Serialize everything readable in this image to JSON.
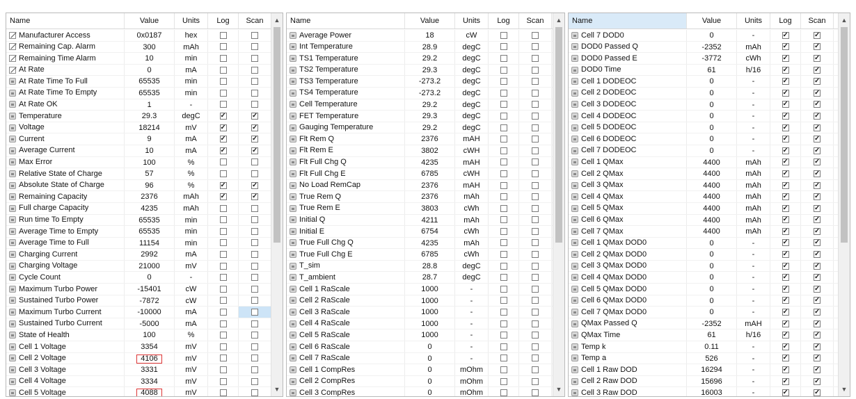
{
  "columns": {
    "name": "Name",
    "value": "Value",
    "units": "Units",
    "log": "Log",
    "scan": "Scan"
  },
  "scroll_icons": {
    "up": "▲",
    "down": "▼"
  },
  "panels": [
    {
      "rows": [
        {
          "name": "Manufacturer Access",
          "value": "0x0187",
          "units": "hex",
          "log": false,
          "scan": false,
          "icon": "pencil"
        },
        {
          "name": "Remaining Cap. Alarm",
          "value": "300",
          "units": "mAh",
          "log": false,
          "scan": false,
          "icon": "pencil"
        },
        {
          "name": "Remaining Time Alarm",
          "value": "10",
          "units": "min",
          "log": false,
          "scan": false,
          "icon": "pencil"
        },
        {
          "name": "At Rate",
          "value": "0",
          "units": "mA",
          "log": false,
          "scan": false,
          "icon": "pencil"
        },
        {
          "name": "At Rate Time To Full",
          "value": "65535",
          "units": "min",
          "log": false,
          "scan": false,
          "icon": "lock"
        },
        {
          "name": "At Rate Time To Empty",
          "value": "65535",
          "units": "min",
          "log": false,
          "scan": false,
          "icon": "lock"
        },
        {
          "name": "At Rate OK",
          "value": "1",
          "units": "-",
          "log": false,
          "scan": false,
          "icon": "lock"
        },
        {
          "name": "Temperature",
          "value": "29.3",
          "units": "degC",
          "log": true,
          "scan": true,
          "icon": "lock"
        },
        {
          "name": "Voltage",
          "value": "18214",
          "units": "mV",
          "log": true,
          "scan": true,
          "icon": "lock"
        },
        {
          "name": "Current",
          "value": "9",
          "units": "mA",
          "log": true,
          "scan": true,
          "icon": "lock"
        },
        {
          "name": "Average Current",
          "value": "10",
          "units": "mA",
          "log": true,
          "scan": true,
          "icon": "lock"
        },
        {
          "name": "Max Error",
          "value": "100",
          "units": "%",
          "log": false,
          "scan": false,
          "icon": "lock"
        },
        {
          "name": "Relative State of Charge",
          "value": "57",
          "units": "%",
          "log": false,
          "scan": false,
          "icon": "lock"
        },
        {
          "name": "Absolute State of Charge",
          "value": "96",
          "units": "%",
          "log": true,
          "scan": true,
          "icon": "lock"
        },
        {
          "name": "Remaining Capacity",
          "value": "2376",
          "units": "mAh",
          "log": true,
          "scan": true,
          "icon": "lock"
        },
        {
          "name": "Full charge Capacity",
          "value": "4235",
          "units": "mAh",
          "log": false,
          "scan": false,
          "icon": "lock"
        },
        {
          "name": "Run time To Empty",
          "value": "65535",
          "units": "min",
          "log": false,
          "scan": false,
          "icon": "lock"
        },
        {
          "name": "Average Time to Empty",
          "value": "65535",
          "units": "min",
          "log": false,
          "scan": false,
          "icon": "lock"
        },
        {
          "name": "Average Time to Full",
          "value": "11154",
          "units": "min",
          "log": false,
          "scan": false,
          "icon": "lock"
        },
        {
          "name": "Charging Current",
          "value": "2992",
          "units": "mA",
          "log": false,
          "scan": false,
          "icon": "lock"
        },
        {
          "name": "Charging Voltage",
          "value": "21000",
          "units": "mV",
          "log": false,
          "scan": false,
          "icon": "lock"
        },
        {
          "name": "Cycle Count",
          "value": "0",
          "units": "-",
          "log": false,
          "scan": false,
          "icon": "lock"
        },
        {
          "name": "Maximum Turbo Power",
          "value": "-15401",
          "units": "cW",
          "log": false,
          "scan": false,
          "icon": "lock"
        },
        {
          "name": "Sustained Turbo Power",
          "value": "-7872",
          "units": "cW",
          "log": false,
          "scan": false,
          "icon": "lock"
        },
        {
          "name": "Maximum Turbo Current",
          "value": "-10000",
          "units": "mA",
          "log": false,
          "scan": false,
          "icon": "lock",
          "scan_hl": true
        },
        {
          "name": "Sustained Turbo Current",
          "value": "-5000",
          "units": "mA",
          "log": false,
          "scan": false,
          "icon": "lock"
        },
        {
          "name": "State of Health",
          "value": "100",
          "units": "%",
          "log": false,
          "scan": false,
          "icon": "lock"
        },
        {
          "name": "Cell 1 Voltage",
          "value": "3354",
          "units": "mV",
          "log": false,
          "scan": false,
          "icon": "lock"
        },
        {
          "name": "Cell 2 Voltage",
          "value": "4106",
          "units": "mV",
          "log": false,
          "scan": false,
          "icon": "lock",
          "flag": true
        },
        {
          "name": "Cell 3 Voltage",
          "value": "3331",
          "units": "mV",
          "log": false,
          "scan": false,
          "icon": "lock"
        },
        {
          "name": "Cell 4 Voltage",
          "value": "3334",
          "units": "mV",
          "log": false,
          "scan": false,
          "icon": "lock"
        },
        {
          "name": "Cell 5 Voltage",
          "value": "4088",
          "units": "mV",
          "log": false,
          "scan": false,
          "icon": "lock",
          "flag": true
        }
      ]
    },
    {
      "rows": [
        {
          "name": "Average Power",
          "value": "18",
          "units": "cW",
          "log": false,
          "scan": false,
          "icon": "lock"
        },
        {
          "name": "Int Temperature",
          "value": "28.9",
          "units": "degC",
          "log": false,
          "scan": false,
          "icon": "lock"
        },
        {
          "name": "TS1 Temperature",
          "value": "29.2",
          "units": "degC",
          "log": false,
          "scan": false,
          "icon": "lock"
        },
        {
          "name": "TS2 Temperature",
          "value": "29.3",
          "units": "degC",
          "log": false,
          "scan": false,
          "icon": "lock"
        },
        {
          "name": "TS3 Temperature",
          "value": "-273.2",
          "units": "degC",
          "log": false,
          "scan": false,
          "icon": "lock"
        },
        {
          "name": "TS4 Temperature",
          "value": "-273.2",
          "units": "degC",
          "log": false,
          "scan": false,
          "icon": "lock"
        },
        {
          "name": "Cell Temperature",
          "value": "29.2",
          "units": "degC",
          "log": false,
          "scan": false,
          "icon": "lock"
        },
        {
          "name": "FET Temperature",
          "value": "29.3",
          "units": "degC",
          "log": false,
          "scan": false,
          "icon": "lock"
        },
        {
          "name": "Gauging Temperature",
          "value": "29.2",
          "units": "degC",
          "log": false,
          "scan": false,
          "icon": "lock"
        },
        {
          "name": "Flt Rem Q",
          "value": "2376",
          "units": "mAH",
          "log": false,
          "scan": false,
          "icon": "lock"
        },
        {
          "name": "Flt Rem E",
          "value": "3802",
          "units": "cWH",
          "log": false,
          "scan": false,
          "icon": "lock"
        },
        {
          "name": "Flt Full Chg Q",
          "value": "4235",
          "units": "mAH",
          "log": false,
          "scan": false,
          "icon": "lock"
        },
        {
          "name": "Flt Full Chg E",
          "value": "6785",
          "units": "cWH",
          "log": false,
          "scan": false,
          "icon": "lock"
        },
        {
          "name": "No Load RemCap",
          "value": "2376",
          "units": "mAH",
          "log": false,
          "scan": false,
          "icon": "lock"
        },
        {
          "name": "True Rem Q",
          "value": "2376",
          "units": "mAh",
          "log": false,
          "scan": false,
          "icon": "lock"
        },
        {
          "name": "True Rem E",
          "value": "3803",
          "units": "cWh",
          "log": false,
          "scan": false,
          "icon": "lock"
        },
        {
          "name": "Initial Q",
          "value": "4211",
          "units": "mAh",
          "log": false,
          "scan": false,
          "icon": "lock"
        },
        {
          "name": "Initial E",
          "value": "6754",
          "units": "cWh",
          "log": false,
          "scan": false,
          "icon": "lock"
        },
        {
          "name": "True Full Chg Q",
          "value": "4235",
          "units": "mAh",
          "log": false,
          "scan": false,
          "icon": "lock"
        },
        {
          "name": "True Full Chg E",
          "value": "6785",
          "units": "cWh",
          "log": false,
          "scan": false,
          "icon": "lock"
        },
        {
          "name": "T_sim",
          "value": "28.8",
          "units": "degC",
          "log": false,
          "scan": false,
          "icon": "lock"
        },
        {
          "name": "T_ambient",
          "value": "28.7",
          "units": "degC",
          "log": false,
          "scan": false,
          "icon": "lock"
        },
        {
          "name": "Cell 1 RaScale",
          "value": "1000",
          "units": "-",
          "log": false,
          "scan": false,
          "icon": "lock"
        },
        {
          "name": "Cell 2 RaScale",
          "value": "1000",
          "units": "-",
          "log": false,
          "scan": false,
          "icon": "lock"
        },
        {
          "name": "Cell 3 RaScale",
          "value": "1000",
          "units": "-",
          "log": false,
          "scan": false,
          "icon": "lock"
        },
        {
          "name": "Cell 4 RaScale",
          "value": "1000",
          "units": "-",
          "log": false,
          "scan": false,
          "icon": "lock"
        },
        {
          "name": "Cell 5 RaScale",
          "value": "1000",
          "units": "-",
          "log": false,
          "scan": false,
          "icon": "lock"
        },
        {
          "name": "Cell 6 RaScale",
          "value": "0",
          "units": "-",
          "log": false,
          "scan": false,
          "icon": "lock"
        },
        {
          "name": "Cell 7 RaScale",
          "value": "0",
          "units": "-",
          "log": false,
          "scan": false,
          "icon": "lock"
        },
        {
          "name": "Cell 1 CompRes",
          "value": "0",
          "units": "mOhm",
          "log": false,
          "scan": false,
          "icon": "lock"
        },
        {
          "name": "Cell 2 CompRes",
          "value": "0",
          "units": "mOhm",
          "log": false,
          "scan": false,
          "icon": "lock"
        },
        {
          "name": "Cell 3 CompRes",
          "value": "0",
          "units": "mOhm",
          "log": false,
          "scan": false,
          "icon": "lock"
        }
      ]
    },
    {
      "name_header_selected": true,
      "rows": [
        {
          "name": "Cell 7 DOD0",
          "value": "0",
          "units": "-",
          "log": true,
          "scan": true,
          "icon": "lock"
        },
        {
          "name": "DOD0 Passed Q",
          "value": "-2352",
          "units": "mAh",
          "log": true,
          "scan": true,
          "icon": "lock"
        },
        {
          "name": "DOD0 Passed E",
          "value": "-3772",
          "units": "cWh",
          "log": true,
          "scan": true,
          "icon": "lock"
        },
        {
          "name": "DOD0 Time",
          "value": "61",
          "units": "h/16",
          "log": true,
          "scan": true,
          "icon": "lock"
        },
        {
          "name": "Cell 1 DODEOC",
          "value": "0",
          "units": "-",
          "log": true,
          "scan": true,
          "icon": "lock"
        },
        {
          "name": "Cell 2 DODEOC",
          "value": "0",
          "units": "-",
          "log": true,
          "scan": true,
          "icon": "lock"
        },
        {
          "name": "Cell 3 DODEOC",
          "value": "0",
          "units": "-",
          "log": true,
          "scan": true,
          "icon": "lock"
        },
        {
          "name": "Cell 4 DODEOC",
          "value": "0",
          "units": "-",
          "log": true,
          "scan": true,
          "icon": "lock"
        },
        {
          "name": "Cell 5 DODEOC",
          "value": "0",
          "units": "-",
          "log": true,
          "scan": true,
          "icon": "lock"
        },
        {
          "name": "Cell 6 DODEOC",
          "value": "0",
          "units": "-",
          "log": true,
          "scan": true,
          "icon": "lock"
        },
        {
          "name": "Cell 7 DODEOC",
          "value": "0",
          "units": "-",
          "log": true,
          "scan": true,
          "icon": "lock"
        },
        {
          "name": "Cell 1 QMax",
          "value": "4400",
          "units": "mAh",
          "log": true,
          "scan": true,
          "icon": "lock"
        },
        {
          "name": "Cell 2 QMax",
          "value": "4400",
          "units": "mAh",
          "log": true,
          "scan": true,
          "icon": "lock"
        },
        {
          "name": "Cell 3 QMax",
          "value": "4400",
          "units": "mAh",
          "log": true,
          "scan": true,
          "icon": "lock"
        },
        {
          "name": "Cell 4 QMax",
          "value": "4400",
          "units": "mAh",
          "log": true,
          "scan": true,
          "icon": "lock"
        },
        {
          "name": "Cell 5 QMax",
          "value": "4400",
          "units": "mAh",
          "log": true,
          "scan": true,
          "icon": "lock"
        },
        {
          "name": "Cell 6 QMax",
          "value": "4400",
          "units": "mAh",
          "log": true,
          "scan": true,
          "icon": "lock"
        },
        {
          "name": "Cell 7 QMax",
          "value": "4400",
          "units": "mAh",
          "log": true,
          "scan": true,
          "icon": "lock"
        },
        {
          "name": "Cell 1 QMax DOD0",
          "value": "0",
          "units": "-",
          "log": true,
          "scan": true,
          "icon": "lock"
        },
        {
          "name": "Cell 2 QMax DOD0",
          "value": "0",
          "units": "-",
          "log": true,
          "scan": true,
          "icon": "lock"
        },
        {
          "name": "Cell 3 QMax DOD0",
          "value": "0",
          "units": "-",
          "log": true,
          "scan": true,
          "icon": "lock"
        },
        {
          "name": "Cell 4 QMax DOD0",
          "value": "0",
          "units": "-",
          "log": true,
          "scan": true,
          "icon": "lock"
        },
        {
          "name": "Cell 5 QMax DOD0",
          "value": "0",
          "units": "-",
          "log": true,
          "scan": true,
          "icon": "lock"
        },
        {
          "name": "Cell 6 QMax DOD0",
          "value": "0",
          "units": "-",
          "log": true,
          "scan": true,
          "icon": "lock"
        },
        {
          "name": "Cell 7 QMax DOD0",
          "value": "0",
          "units": "-",
          "log": true,
          "scan": true,
          "icon": "lock"
        },
        {
          "name": "QMax Passed Q",
          "value": "-2352",
          "units": "mAH",
          "log": true,
          "scan": true,
          "icon": "lock"
        },
        {
          "name": "QMax Time",
          "value": "61",
          "units": "h/16",
          "log": true,
          "scan": true,
          "icon": "lock"
        },
        {
          "name": "Temp k",
          "value": "0.11",
          "units": "-",
          "log": true,
          "scan": true,
          "icon": "lock"
        },
        {
          "name": "Temp a",
          "value": "526",
          "units": "-",
          "log": true,
          "scan": true,
          "icon": "lock"
        },
        {
          "name": "Cell 1 Raw DOD",
          "value": "16294",
          "units": "-",
          "log": true,
          "scan": true,
          "icon": "lock"
        },
        {
          "name": "Cell 2 Raw DOD",
          "value": "15696",
          "units": "-",
          "log": true,
          "scan": true,
          "icon": "lock"
        },
        {
          "name": "Cell 3 Raw DOD",
          "value": "16003",
          "units": "-",
          "log": true,
          "scan": true,
          "icon": "lock"
        }
      ]
    }
  ]
}
